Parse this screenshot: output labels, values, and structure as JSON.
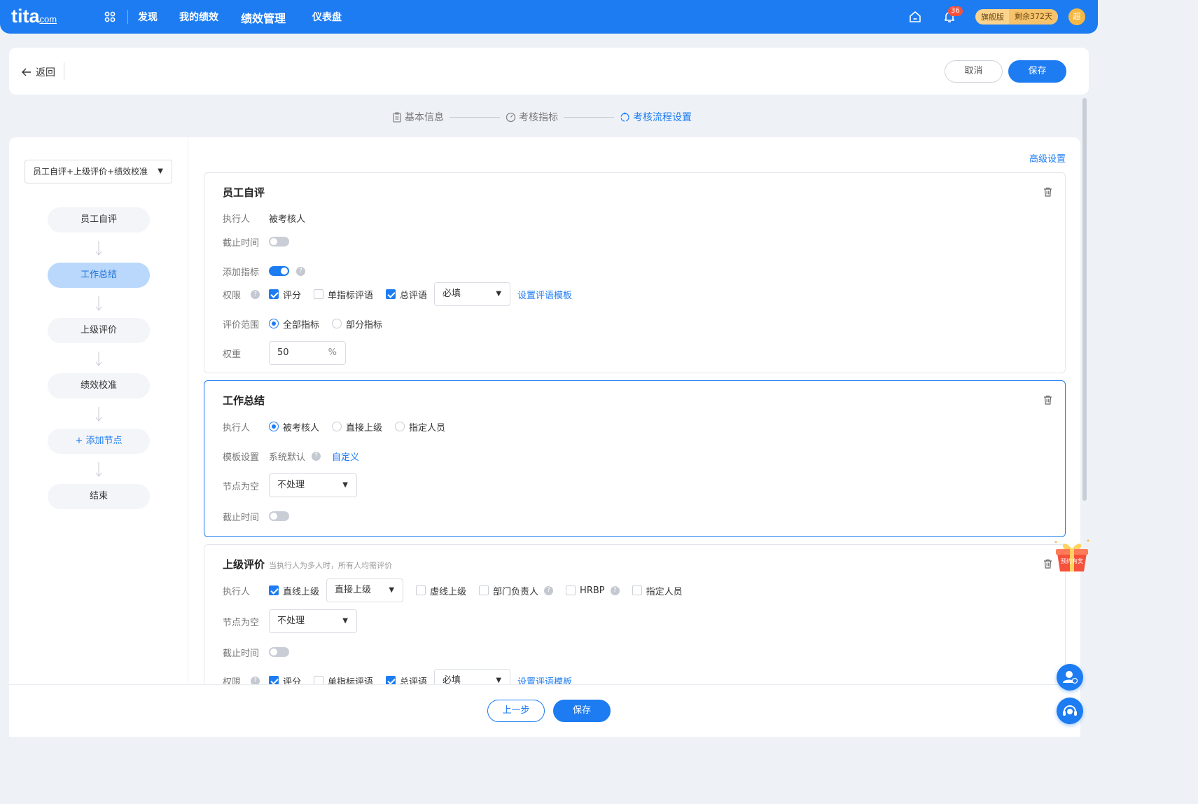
{
  "topbar": {
    "logo": "tita",
    "logo_suffix": "com",
    "nav": [
      "发现",
      "我的绩效",
      "绩效管理",
      "仪表盘"
    ],
    "notification_count": "36",
    "plan": "旗舰版",
    "remaining": "剩余372天",
    "avatar_text": "超"
  },
  "header": {
    "back_label": "返回",
    "cancel_label": "取消",
    "save_label": "保存"
  },
  "steps": [
    "基本信息",
    "考核指标",
    "考核流程设置"
  ],
  "left_panel": {
    "flow_select": "员工自评+上级评价+绩效校准",
    "nodes": [
      "员工自评",
      "工作总结",
      "上级评价",
      "绩效校准"
    ],
    "add_node": "添加节点",
    "end_node": "结束"
  },
  "advanced_settings": "高级设置",
  "card1": {
    "title": "员工自评",
    "executor_label": "执行人",
    "executor_value": "被考核人",
    "deadline_label": "截止时间",
    "add_indicator_label": "添加指标",
    "permission_label": "权限",
    "opt_score": "评分",
    "opt_single_comment": "单指标评语",
    "opt_total_comment": "总评语",
    "required_select": "必填",
    "template_link": "设置评语模板",
    "scope_label": "评价范围",
    "scope_all": "全部指标",
    "scope_part": "部分指标",
    "weight_label": "权重",
    "weight_value": "50",
    "weight_unit": "%"
  },
  "card2": {
    "title": "工作总结",
    "executor_label": "执行人",
    "exec_opt1": "被考核人",
    "exec_opt2": "直接上级",
    "exec_opt3": "指定人员",
    "template_label": "模板设置",
    "template_value": "系统默认",
    "custom_link": "自定义",
    "empty_label": "节点为空",
    "empty_select": "不处理",
    "deadline_label": "截止时间"
  },
  "card3": {
    "title": "上级评价",
    "hint": "当执行人为多人时，所有人均需评价",
    "executor_label": "执行人",
    "opt_direct_line": "直线上级",
    "direct_select": "直接上级",
    "opt_virtual": "虚线上级",
    "opt_dept_head": "部门负责人",
    "opt_hrbp": "HRBP",
    "opt_assigned": "指定人员",
    "empty_label": "节点为空",
    "empty_select": "不处理",
    "deadline_label": "截止时间",
    "permission_label": "权限",
    "opt_score": "评分",
    "opt_single_comment": "单指标评语",
    "opt_total_comment": "总评语",
    "required_select": "必填",
    "template_link": "设置评语模板"
  },
  "footer": {
    "prev_label": "上一步",
    "save_label": "保存"
  },
  "gift_text": "预约有奖",
  "colors": {
    "primary": "#1d7cf2",
    "badge": "#f5513d",
    "plan_gold": "#fbd38d"
  },
  "icons": [
    "apps-icon",
    "home-icon",
    "bell-icon",
    "back-arrow-icon",
    "document-icon",
    "target-icon",
    "flow-icon",
    "trash-icon",
    "help-icon",
    "contact-icon",
    "service-icon",
    "gift-icon"
  ]
}
